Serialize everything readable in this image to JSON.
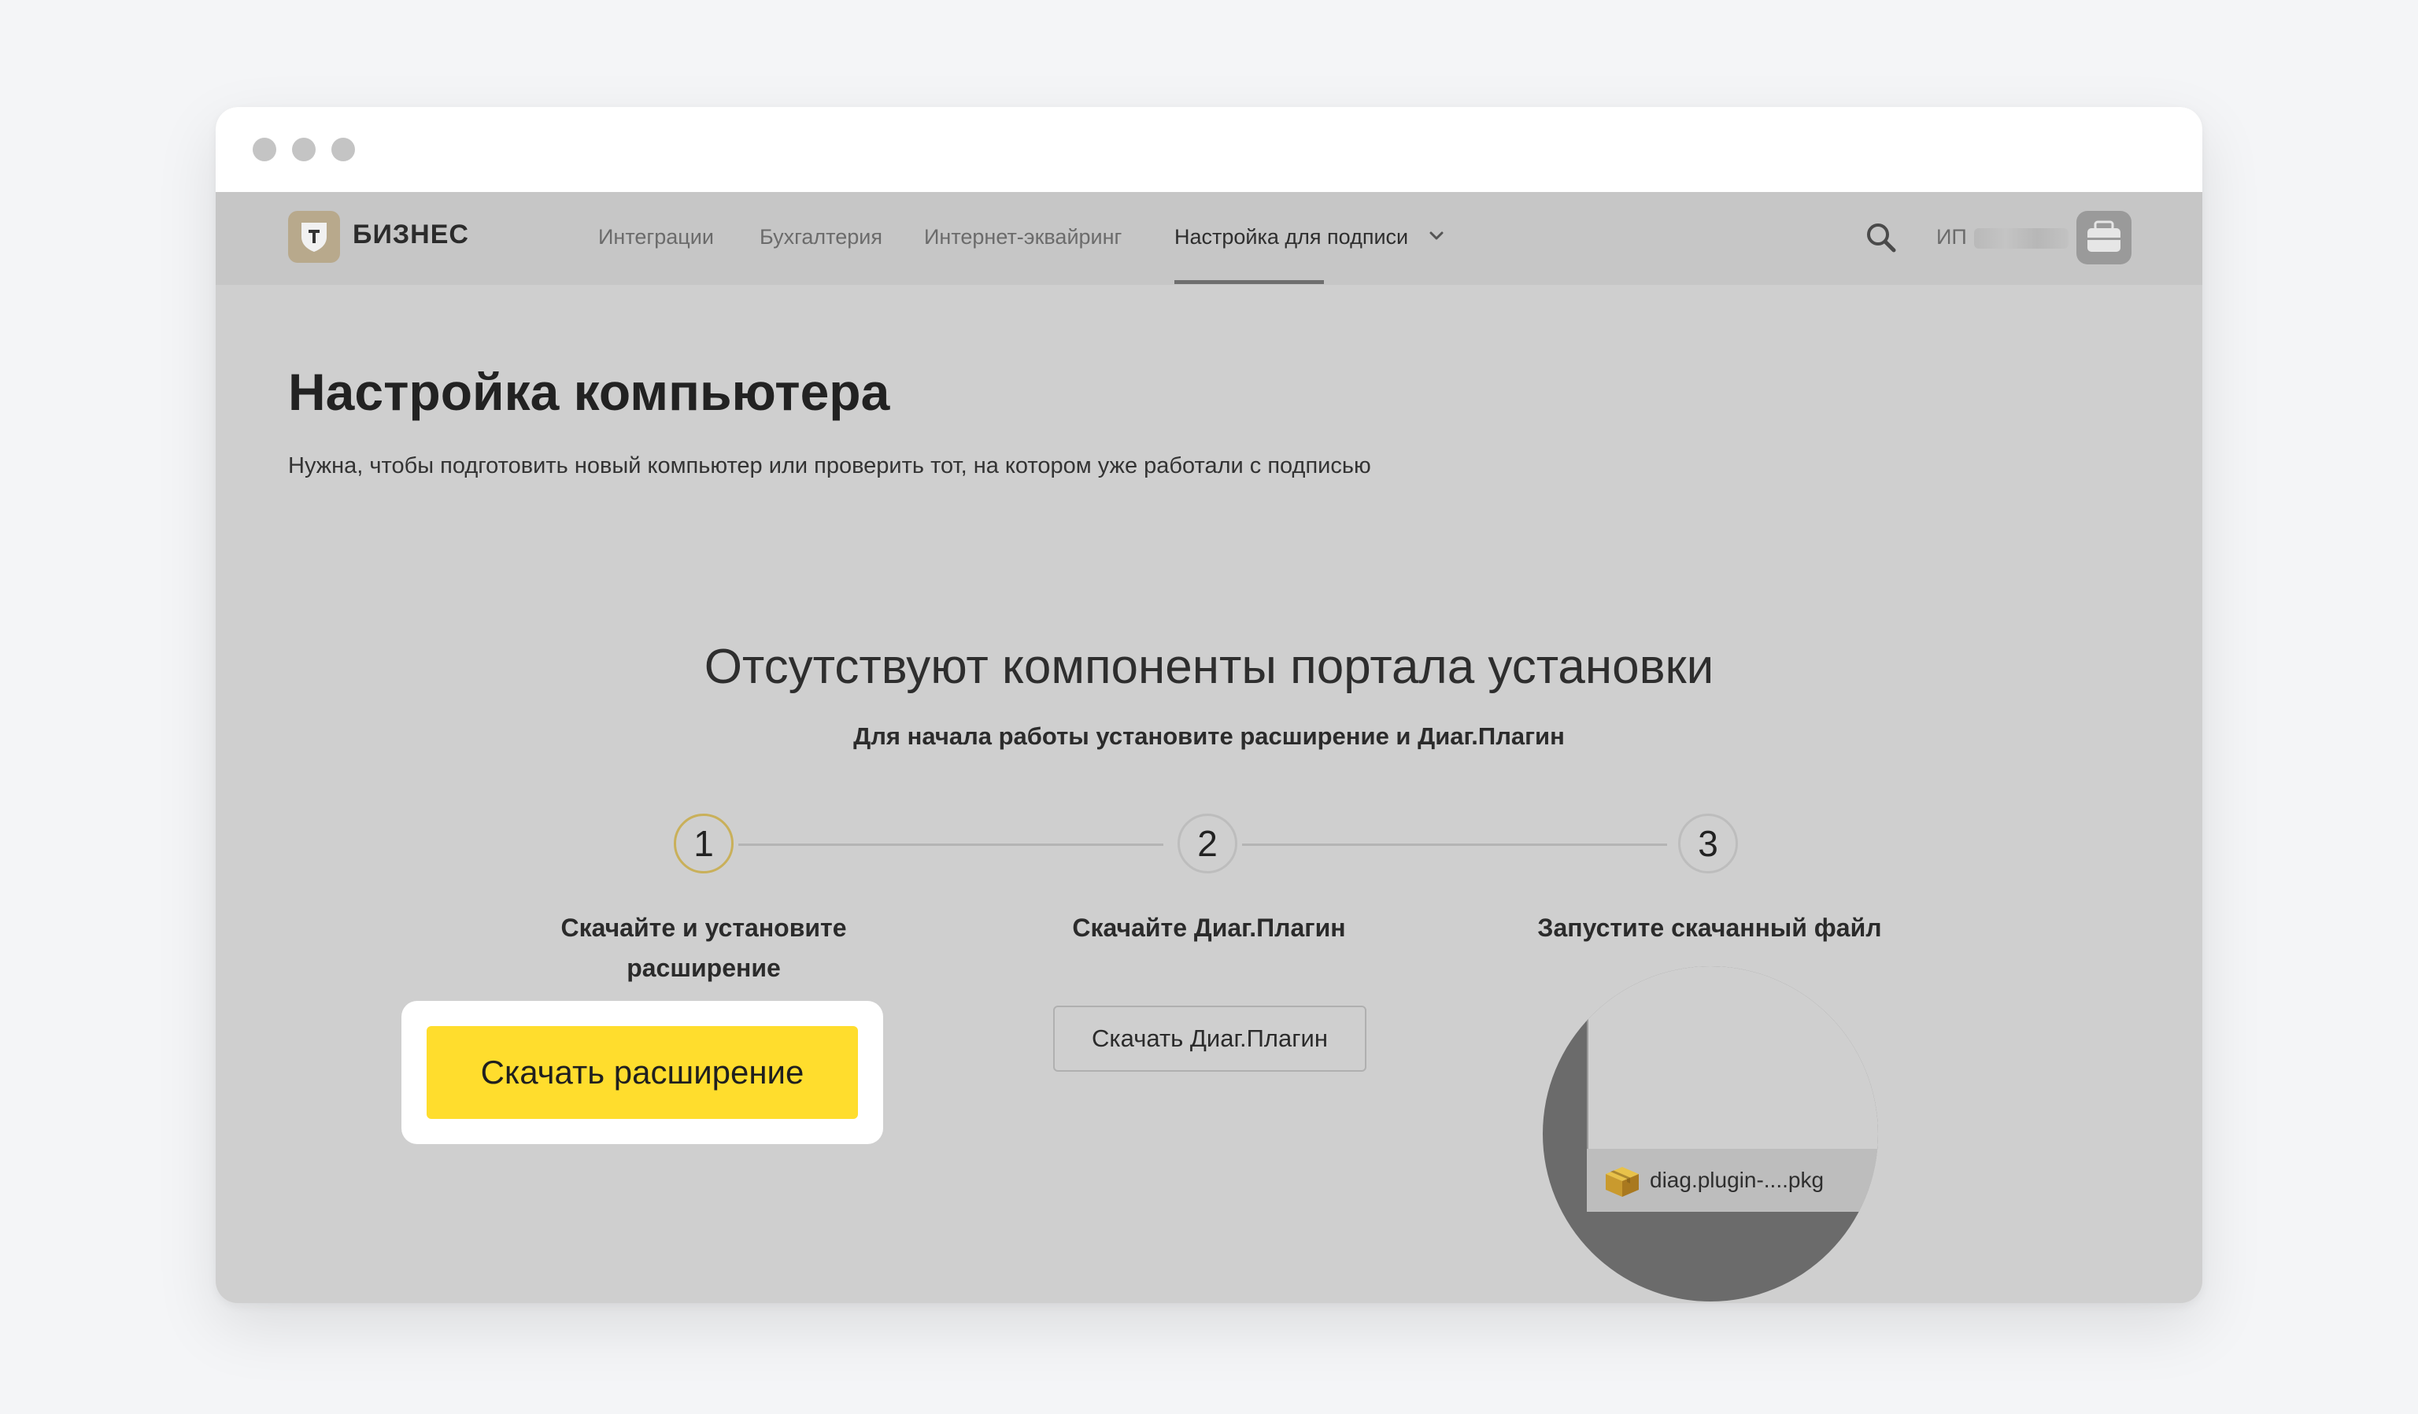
{
  "header": {
    "logo_text": "БИЗНЕС",
    "nav": [
      {
        "label": "Интеграции"
      },
      {
        "label": "Бухгалтерия"
      },
      {
        "label": "Интернет-эквайринг"
      },
      {
        "label": "Настройка для подписи",
        "active": true
      }
    ],
    "user_prefix": "ИП"
  },
  "page": {
    "title": "Настройка компьютера",
    "subtitle": "Нужна, чтобы подготовить новый компьютер или проверить тот, на котором уже работали с подписью"
  },
  "setup": {
    "title": "Отсутствуют компоненты портала установки",
    "subtitle": "Для начала работы установите расширение и Диаг.Плагин",
    "steps": [
      {
        "number": "1",
        "label_line1": "Скачайте и установите",
        "label_line2": "расширение",
        "button": "Скачать расширение"
      },
      {
        "number": "2",
        "label_line1": "Скачайте Диаг.Плагин",
        "button": "Скачать Диаг.Плагин"
      },
      {
        "number": "3",
        "label_line1": "Запустите скачанный файл",
        "file_name": "diag.plugin-....pkg"
      }
    ]
  },
  "colors": {
    "accent_yellow": "#ffdd2d",
    "active_step_ring": "#c9b05a",
    "overlay_gray": "#cfcfcf"
  }
}
